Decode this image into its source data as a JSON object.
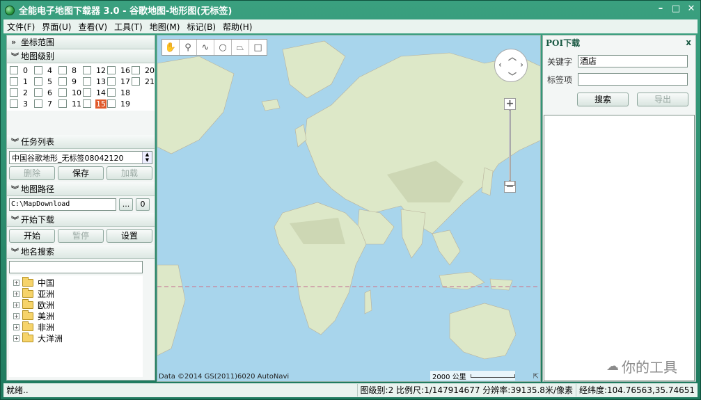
{
  "window": {
    "title": "全能电子地图下载器 3.0 - 谷歌地图-地形图(无标签)"
  },
  "menu": [
    "文件(F)",
    "界面(U)",
    "查看(V)",
    "工具(T)",
    "地图(M)",
    "标记(B)",
    "帮助(H)"
  ],
  "left": {
    "coord_range": "坐标范围",
    "map_level": "地图级别",
    "levels": [
      [
        "0",
        "4",
        "8",
        "12",
        "16",
        "20"
      ],
      [
        "1",
        "5",
        "9",
        "13",
        "17",
        "21"
      ],
      [
        "2",
        "6",
        "10",
        "14",
        "18",
        ""
      ],
      [
        "3",
        "7",
        "11",
        "15",
        "19",
        ""
      ]
    ],
    "selected_level": "15",
    "task_list": "任务列表",
    "task_value": "中国谷歌地形_无标签08042120",
    "delete_label": "删除",
    "save_label": "保存",
    "load_label": "加载",
    "map_path": "地图路径",
    "path_value": "C:\\MapDownload",
    "browse_label": "...",
    "open_label": "0",
    "start_download": "开始下载",
    "start_label": "开始",
    "pause_label": "暂停",
    "settings_label": "设置",
    "place_search": "地名搜索",
    "tree": [
      "中国",
      "亚洲",
      "欧洲",
      "美洲",
      "非洲",
      "大洋洲"
    ]
  },
  "map": {
    "copyright": "Data ©2014 GS(2011)6020 AutoNavi",
    "scale": "2000 公里"
  },
  "poi": {
    "title": "POI下载",
    "close": "x",
    "keyword_label": "关键字",
    "keyword_value": "酒店",
    "tag_label": "标签项",
    "tag_value": "",
    "search_label": "搜索",
    "export_label": "导出",
    "watermark": "你的工具"
  },
  "status": {
    "ready": "就绪..",
    "info": "图级别:2 比例尺:1/147914677 分辨率:39135.8米/像素",
    "coords": "经纬度:104.76563,35.74651"
  },
  "colors": {
    "frame": "#2f8a6e",
    "ocean": "#a8d5ec",
    "land": "#d8e6c4",
    "selected_level": "#e05a2b"
  }
}
